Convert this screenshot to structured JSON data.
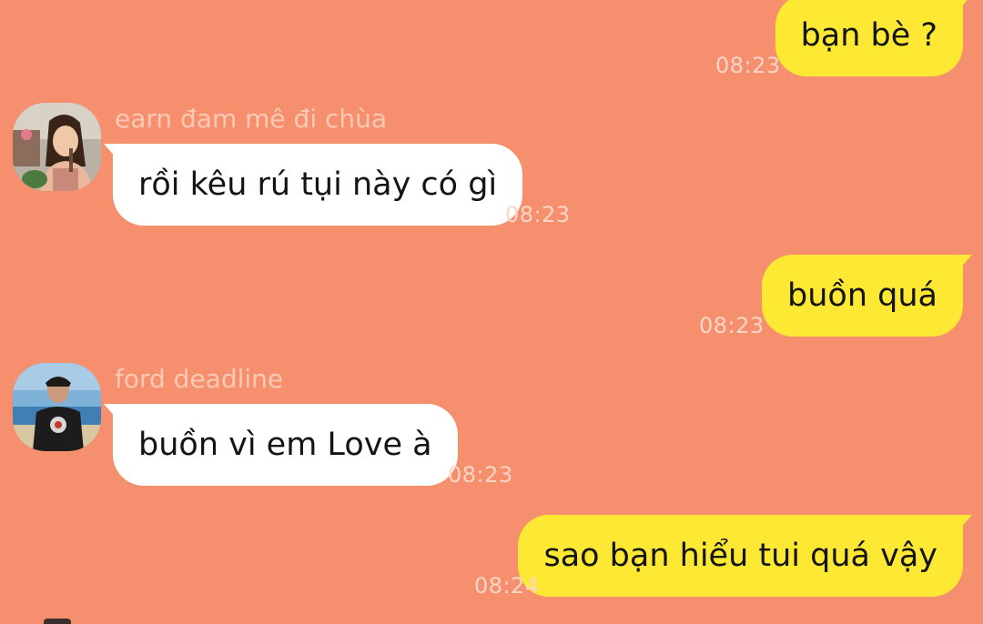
{
  "messages": [
    {
      "direction": "outgoing",
      "text": "bạn bè ?",
      "time": "08:23"
    },
    {
      "direction": "incoming",
      "sender": "earn đam mê đi chùa",
      "text": "rồi kêu rú tụi này có gì",
      "time": "08:23",
      "avatar_icon": "avatar-woman-photo-icon"
    },
    {
      "direction": "outgoing",
      "text": "buồn quá",
      "time": "08:23"
    },
    {
      "direction": "incoming",
      "sender": "ford deadline",
      "text": "buồn vì em Love à",
      "time": "08:23",
      "avatar_icon": "avatar-man-beach-photo-icon"
    },
    {
      "direction": "outgoing",
      "text": "sao bạn hiểu tui quá vậy",
      "time": "08:24"
    }
  ],
  "colors": {
    "background": "#f58f6e",
    "outgoing_bubble": "#fde833",
    "incoming_bubble": "#ffffff",
    "timestamp": "#fbd6c6",
    "sender_name": "#fcc9b4"
  }
}
